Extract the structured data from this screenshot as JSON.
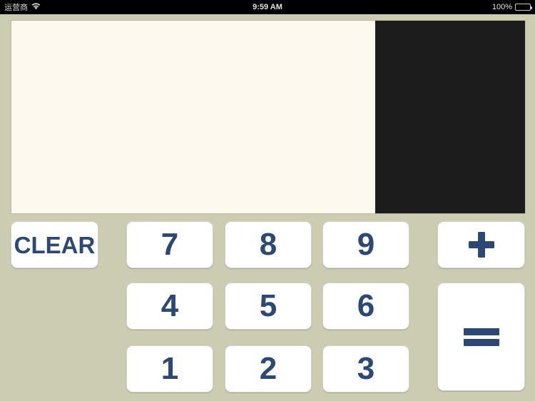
{
  "status_bar": {
    "carrier": "运营商",
    "wifi_icon": "wifi-icon",
    "time": "9:59 AM",
    "battery_percent": "100%",
    "battery_icon": "battery-full-icon"
  },
  "display": {
    "paper_color": "#fdf9ee",
    "dark_panel_color": "#1c1c1c",
    "content": ""
  },
  "theme": {
    "body_color": "#ccccb3",
    "key_color": "#ffffff",
    "key_text_color": "#2e4874"
  },
  "keypad": {
    "clear": {
      "label": "CLEAR",
      "name": "clear-button"
    },
    "numbers": [
      {
        "label": "7",
        "name": "key-7"
      },
      {
        "label": "8",
        "name": "key-8"
      },
      {
        "label": "9",
        "name": "key-9"
      },
      {
        "label": "4",
        "name": "key-4"
      },
      {
        "label": "5",
        "name": "key-5"
      },
      {
        "label": "6",
        "name": "key-6"
      },
      {
        "label": "1",
        "name": "key-1"
      },
      {
        "label": "2",
        "name": "key-2"
      },
      {
        "label": "3",
        "name": "key-3"
      }
    ],
    "plus": {
      "label": "+",
      "name": "plus-button"
    },
    "equals": {
      "label": "=",
      "name": "equals-button"
    }
  }
}
